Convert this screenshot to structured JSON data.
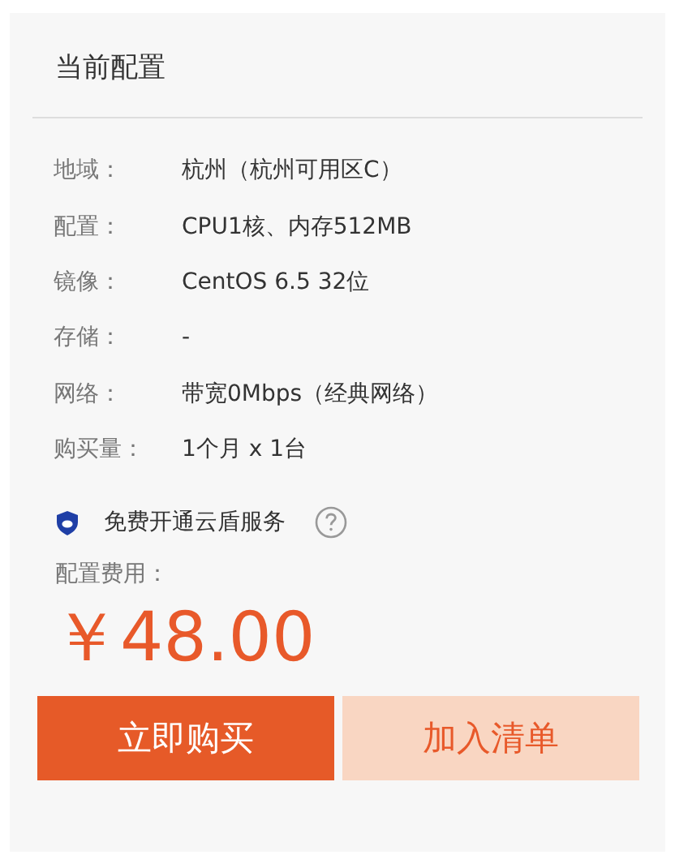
{
  "panel": {
    "title": "当前配置"
  },
  "specs": [
    {
      "label": "地域：",
      "value": "杭州（杭州可用区C）"
    },
    {
      "label": "配置：",
      "value": "CPU1核、内存512MB"
    },
    {
      "label": "镜像：",
      "value": "CentOS 6.5 32位"
    },
    {
      "label": "存储：",
      "value": "-"
    },
    {
      "label": "网络：",
      "value": "带宽0Mbps（经典网络）"
    },
    {
      "label": "购买量：",
      "value": "1个月 x 1台"
    }
  ],
  "security": {
    "label": "免费开通云盾服务"
  },
  "cost": {
    "label": "配置费用：",
    "price": "￥48.00"
  },
  "buttons": [
    {
      "label": "立即购买",
      "kind": "primary"
    },
    {
      "label": "加入清单",
      "kind": "secondary"
    }
  ]
}
